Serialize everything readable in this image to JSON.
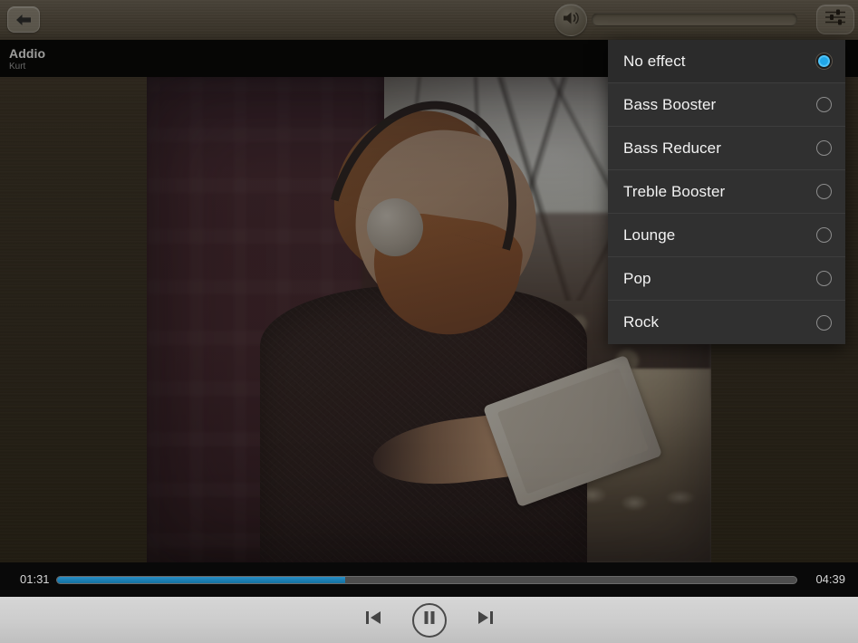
{
  "app": {
    "name": "music-player"
  },
  "topbar": {
    "back_icon": "back-arrow-icon",
    "volume_icon": "speaker-volume-icon",
    "volume_slider_value": 0,
    "equalizer_icon": "equalizer-settings-icon"
  },
  "track": {
    "title": "Addio",
    "artist": "Kurt"
  },
  "artwork": {
    "description": "bearded man wearing headphones holding a tablet on a city street"
  },
  "effects_menu": {
    "selected": "No effect",
    "items": [
      {
        "label": "No effect",
        "selected": true
      },
      {
        "label": "Bass Booster",
        "selected": false
      },
      {
        "label": "Bass Reducer",
        "selected": false
      },
      {
        "label": "Treble Booster",
        "selected": false
      },
      {
        "label": "Lounge",
        "selected": false
      },
      {
        "label": "Pop",
        "selected": false
      },
      {
        "label": "Rock",
        "selected": false
      }
    ]
  },
  "playback": {
    "current_time": "01:31",
    "total_time": "04:39",
    "progress_percent": 39,
    "accent_color": "#1b7fb5"
  },
  "transport": {
    "previous_icon": "previous-track-icon",
    "play_pause_icon": "pause-icon",
    "next_icon": "next-track-icon",
    "state": "playing"
  }
}
